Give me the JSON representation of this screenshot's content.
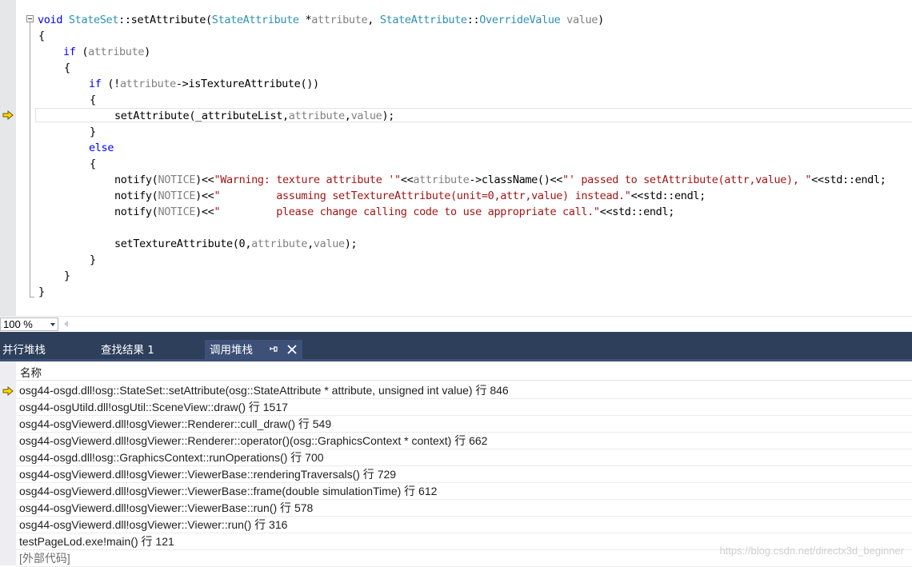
{
  "editor": {
    "lines": [
      [
        [
          "kw",
          "void "
        ],
        [
          "ty",
          "StateSet"
        ],
        [
          "",
          "::setAttribute("
        ],
        [
          "ty",
          "StateAttribute"
        ],
        [
          "",
          " *"
        ],
        [
          "pa",
          "attribute"
        ],
        [
          "",
          ", "
        ],
        [
          "ty",
          "StateAttribute"
        ],
        [
          "",
          "::"
        ],
        [
          "ty",
          "OverrideValue"
        ],
        [
          "",
          " "
        ],
        [
          "pa",
          "value"
        ],
        [
          "",
          ")"
        ]
      ],
      [
        [
          "",
          "{"
        ]
      ],
      [
        [
          "kw",
          "if"
        ],
        [
          "",
          " ("
        ],
        [
          "pa",
          "attribute"
        ],
        [
          "",
          ")"
        ]
      ],
      [
        [
          "",
          "{"
        ]
      ],
      [
        [
          "kw",
          "if"
        ],
        [
          "",
          " (!"
        ],
        [
          "pa",
          "attribute"
        ],
        [
          "",
          "->isTextureAttribute())"
        ]
      ],
      [
        [
          "",
          "{"
        ]
      ],
      [
        [
          "",
          "setAttribute(_attributeList,"
        ],
        [
          "pa",
          "attribute"
        ],
        [
          "",
          ","
        ],
        [
          "pa",
          "value"
        ],
        [
          "",
          ");"
        ]
      ],
      [
        [
          "",
          "}"
        ]
      ],
      [
        [
          "kw",
          "else"
        ]
      ],
      [
        [
          "",
          "{"
        ]
      ],
      [
        [
          "",
          "notify("
        ],
        [
          "pa",
          "NOTICE"
        ],
        [
          "",
          ")<<"
        ],
        [
          "st",
          "\"Warning: texture attribute '\""
        ],
        [
          "",
          "<<"
        ],
        [
          "pa",
          "attribute"
        ],
        [
          "",
          "->className()<<"
        ],
        [
          "st",
          "\"' passed to setAttribute(attr,value), \""
        ],
        [
          "",
          "<<std::endl;"
        ]
      ],
      [
        [
          "",
          "notify("
        ],
        [
          "pa",
          "NOTICE"
        ],
        [
          "",
          ")<<"
        ],
        [
          "st",
          "\"         assuming setTextureAttribute(unit=0,attr,value) instead.\""
        ],
        [
          "",
          "<<std::endl;"
        ]
      ],
      [
        [
          "",
          "notify("
        ],
        [
          "pa",
          "NOTICE"
        ],
        [
          "",
          ")<<"
        ],
        [
          "st",
          "\"         please change calling code to use appropriate call.\""
        ],
        [
          "",
          "<<std::endl;"
        ]
      ],
      [],
      [
        [
          "",
          "setTextureAttribute(0,"
        ],
        [
          "pa",
          "attribute"
        ],
        [
          "",
          ","
        ],
        [
          "pa",
          "value"
        ],
        [
          "",
          ");"
        ]
      ],
      [
        [
          "",
          "}"
        ]
      ],
      [
        [
          "",
          "}"
        ]
      ],
      [
        [
          "",
          "}"
        ]
      ]
    ]
  },
  "zoom": {
    "value": "100 %"
  },
  "tabs": {
    "parallel_stacks": "并行堆栈",
    "find_results": "查找结果 1",
    "call_stack": "调用堆栈"
  },
  "callstack": {
    "header": "名称",
    "rows": [
      "osg44-osgd.dll!osg::StateSet::setAttribute(osg::StateAttribute * attribute, unsigned int value) 行 846",
      "osg44-osgUtild.dll!osgUtil::SceneView::draw() 行 1517",
      "osg44-osgViewerd.dll!osgViewer::Renderer::cull_draw() 行 549",
      "osg44-osgViewerd.dll!osgViewer::Renderer::operator()(osg::GraphicsContext * context) 行 662",
      "osg44-osgd.dll!osg::GraphicsContext::runOperations() 行 700",
      "osg44-osgViewerd.dll!osgViewer::ViewerBase::renderingTraversals() 行 729",
      "osg44-osgViewerd.dll!osgViewer::ViewerBase::frame(double simulationTime) 行 612",
      "osg44-osgViewerd.dll!osgViewer::ViewerBase::run() 行 578",
      "osg44-osgViewerd.dll!osgViewer::Viewer::run() 行 316",
      "testPageLod.exe!main() 行 121",
      "[外部代码]"
    ]
  },
  "watermark": "https://blog.csdn.net/directx3d_beginner",
  "colors": {
    "keyword": "#0000ff",
    "type": "#2b91af",
    "param": "#808080",
    "string": "#a31515",
    "tabbar": "#2e3f5c",
    "arrow": "#ffd800"
  }
}
